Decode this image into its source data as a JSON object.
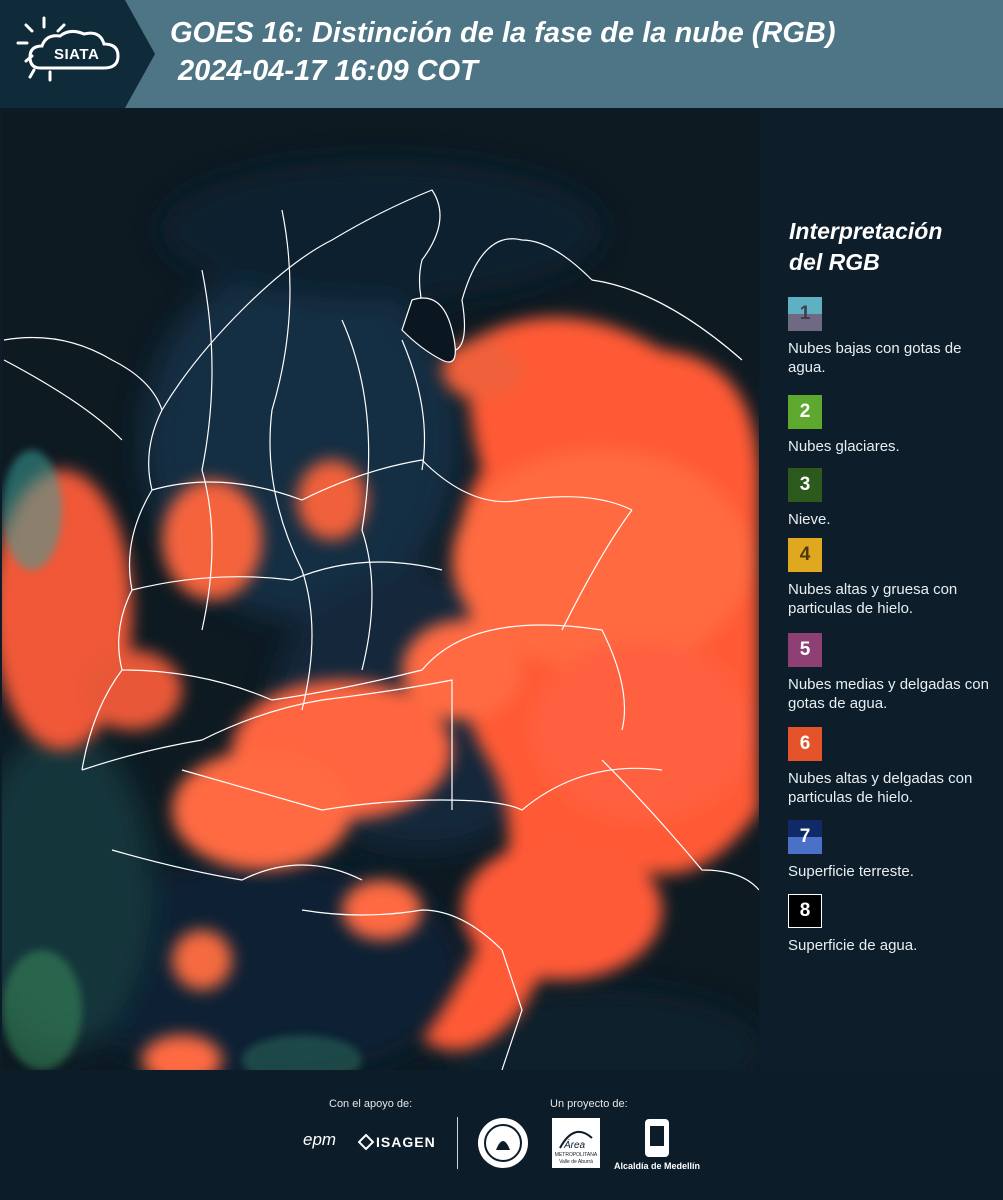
{
  "header": {
    "logo_text": "SIATA",
    "title_line1": "GOES 16: Distinción de la fase de la nube (RGB)",
    "title_line2": "2024-04-17 16:09 COT"
  },
  "legend": {
    "title_line1": "Interpretación",
    "title_line2": "del RGB",
    "items": [
      {
        "number": "1",
        "label": "Nubes bajas con gotas de agua.",
        "color_top": "#5fb0c2",
        "color_bottom": "#6e6a84",
        "number_color": "#4a4a5a"
      },
      {
        "number": "2",
        "label": "Nubes glaciares.",
        "color_top": "#5ea830",
        "color_bottom": "#5ea830",
        "number_color": "#ffffff"
      },
      {
        "number": "3",
        "label": "Nieve.",
        "color_top": "#2c5a1c",
        "color_bottom": "#2c5a1c",
        "number_color": "#ffffff"
      },
      {
        "number": "4",
        "label": "Nubes altas y gruesa con particulas de hielo.",
        "color_top": "#e0a81e",
        "color_bottom": "#e0a81e",
        "number_color": "#4a3a10"
      },
      {
        "number": "5",
        "label": "Nubes medias y delgadas con gotas de agua.",
        "color_top": "#8e3f74",
        "color_bottom": "#8e3f74",
        "number_color": "#ffffff"
      },
      {
        "number": "6",
        "label": "Nubes altas y delgadas con particulas de hielo.",
        "color_top": "#e4532a",
        "color_bottom": "#e4532a",
        "number_color": "#ffffff"
      },
      {
        "number": "7",
        "label": "Superficie terreste.",
        "color_top": "#0f2a66",
        "color_bottom": "#4a70c8",
        "number_color": "#ffffff"
      },
      {
        "number": "8",
        "label": "Superficie de agua.",
        "color_top": "#000000",
        "color_bottom": "#000000",
        "number_color": "#ffffff"
      }
    ]
  },
  "footer": {
    "support_label": "Con el apoyo de:",
    "project_label": "Un proyecto de:",
    "epm": "epm",
    "isagen": "ISAGEN",
    "area_top": "Área",
    "area_line1": "METROPOLITANA",
    "area_line2": "Valle de Aburrá",
    "alcaldia": "Alcaldía de Medellín"
  }
}
